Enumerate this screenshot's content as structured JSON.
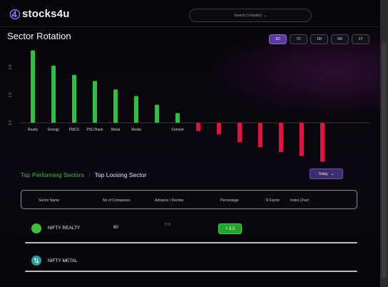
{
  "app": {
    "brand": "stocks4u"
  },
  "search": {
    "placeholder": "Search Company"
  },
  "page": {
    "title": "Sector Rotation"
  },
  "timeframes": [
    "1D",
    "7D",
    "1M",
    "6M",
    "1Y"
  ],
  "timeframe_active": "1D",
  "colors": {
    "accent": "#5a3aa0",
    "positive": "#2fc13a",
    "negative": "#e8103c"
  },
  "chart_data": {
    "type": "bar",
    "categories": [
      "Realty",
      "Energy",
      "FMCG",
      "PSU Bank",
      "Metal",
      "Media",
      "",
      "Cement",
      "",
      "",
      "",
      "",
      "",
      "",
      ""
    ],
    "values": [
      2.6,
      2.05,
      1.72,
      1.5,
      1.2,
      0.96,
      0.65,
      0.35,
      -0.3,
      -0.42,
      -0.7,
      -0.88,
      -1.05,
      -1.2,
      -1.4
    ],
    "yticks": [
      "2.0",
      "1.0",
      "0.0"
    ],
    "ylim": [
      -1.5,
      2.8
    ],
    "grid": false
  },
  "tabs": {
    "top_performing": "Top Performing Sectors",
    "separator": "|",
    "top_loosing": "Top Loosing Sector"
  },
  "period_dropdown": {
    "label": "Today"
  },
  "table": {
    "headers": [
      "Sector Name",
      "No of Companies",
      "Advance / Decline",
      "Percentage",
      "R Factor",
      "Index Chart"
    ],
    "rows": [
      {
        "name": "NIFTY REALTY",
        "companies": "60",
        "advance_decline": "7/ 6",
        "percentage": "+ 3.0"
      },
      {
        "name": "NIFTY METAL"
      }
    ]
  }
}
